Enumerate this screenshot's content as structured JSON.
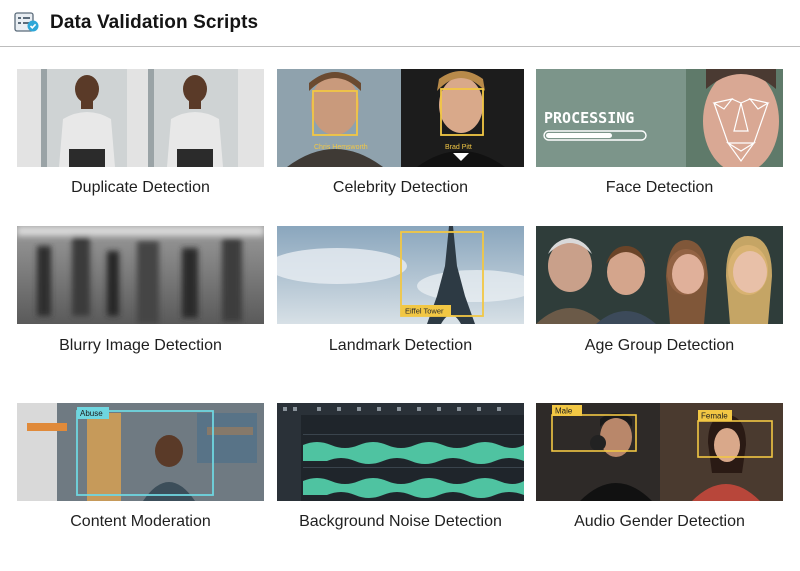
{
  "header": {
    "title": "Data Validation Scripts",
    "logo_icon": "script-list-icon"
  },
  "cards": [
    {
      "label": "Duplicate Detection",
      "icon": "duplicate-photo-thumbnail"
    },
    {
      "label": "Celebrity Detection",
      "icon": "celebrity-faces-thumbnail",
      "tags": [
        "Chris Hemsworth",
        "Brad Pitt"
      ]
    },
    {
      "label": "Face Detection",
      "icon": "face-mesh-thumbnail",
      "overlay_text": "PROCESSING"
    },
    {
      "label": "Blurry Image Detection",
      "icon": "blurred-crowd-thumbnail"
    },
    {
      "label": "Landmark Detection",
      "icon": "landmark-thumbnail",
      "tags": [
        "Eiffel Tower"
      ]
    },
    {
      "label": "Age Group Detection",
      "icon": "age-group-thumbnail"
    },
    {
      "label": "Content Moderation",
      "icon": "moderation-thumbnail",
      "tags": [
        "Abuse"
      ]
    },
    {
      "label": "Background Noise Detection",
      "icon": "waveform-thumbnail"
    },
    {
      "label": "Audio Gender Detection",
      "icon": "audio-gender-thumbnail",
      "tags": [
        "Male",
        "Female"
      ]
    }
  ],
  "colors": {
    "detection_box": "#f2c744",
    "moderation_box": "#6fd6e0",
    "waveform": "#4fc3a1",
    "header_border": "#bdbdbd"
  }
}
